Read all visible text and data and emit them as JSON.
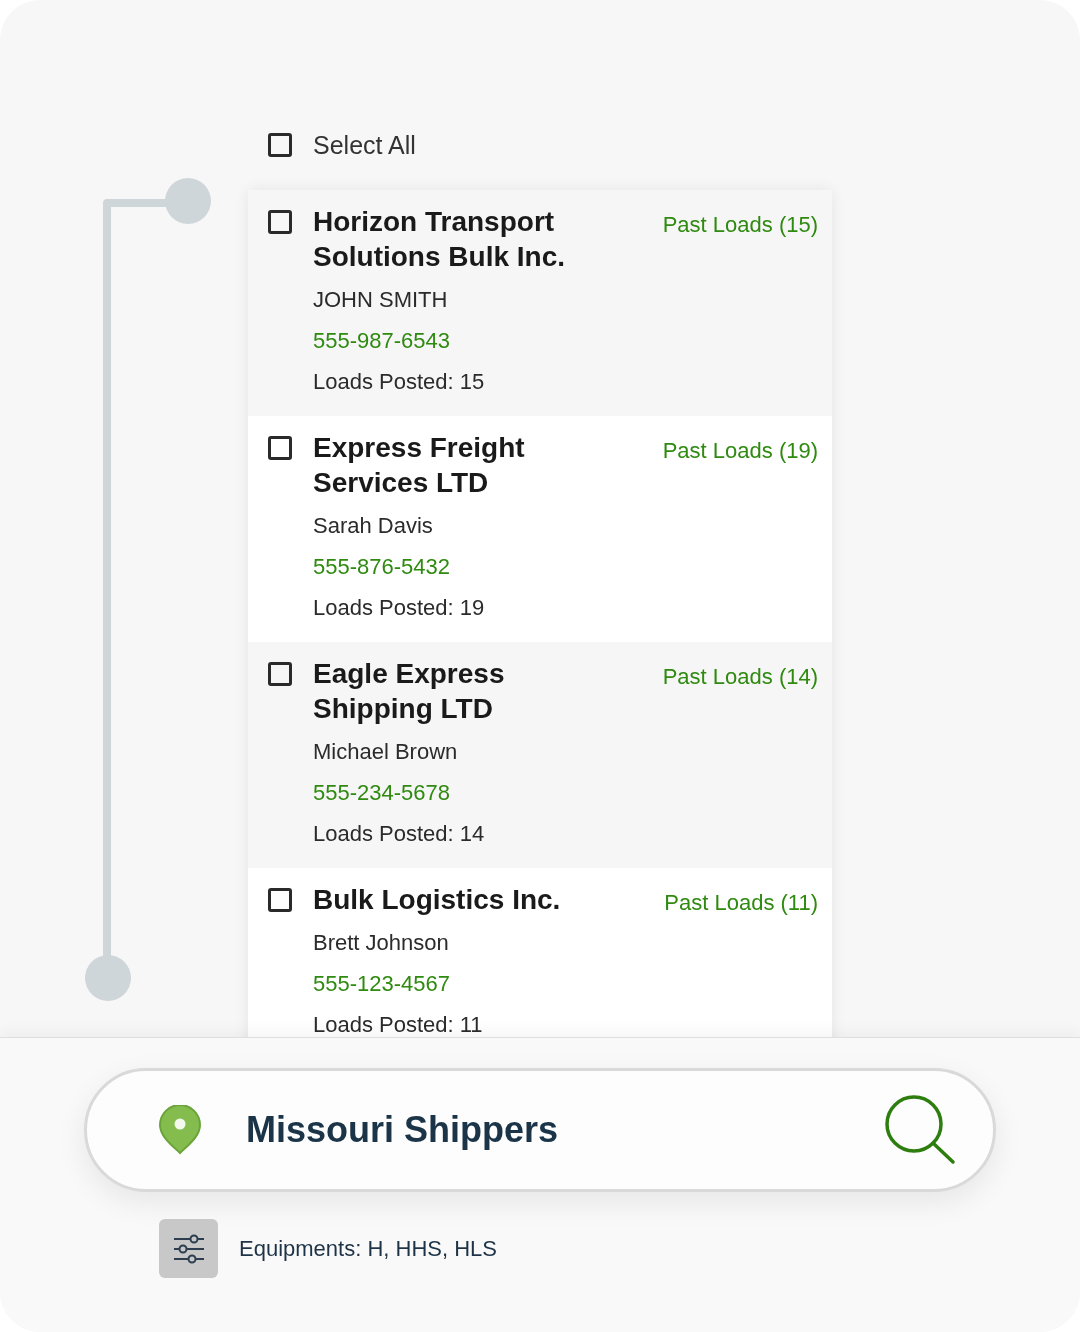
{
  "select_all": {
    "label": "Select All",
    "checked": false
  },
  "shippers": [
    {
      "name": "Horizon Transport Solutions Bulk Inc.",
      "past_loads": "Past Loads (15)",
      "contact": "JOHN SMITH",
      "phone": "555-987-6543",
      "loads_posted": "Loads Posted: 15",
      "checked": false
    },
    {
      "name": "Express Freight Services LTD",
      "past_loads": "Past Loads (19)",
      "contact": "Sarah Davis",
      "phone": "555-876-5432",
      "loads_posted": "Loads Posted: 19",
      "checked": false
    },
    {
      "name": "Eagle Express Shipping LTD",
      "past_loads": "Past Loads (14)",
      "contact": "Michael Brown",
      "phone": "555-234-5678",
      "loads_posted": "Loads Posted: 14",
      "checked": false
    },
    {
      "name": "Bulk Logistics Inc.",
      "past_loads": "Past Loads (11)",
      "contact": "Brett Johnson",
      "phone": "555-123-4567",
      "loads_posted": "Loads Posted: 11",
      "checked": false
    }
  ],
  "search": {
    "value": "Missouri Shippers"
  },
  "filter": {
    "label": "Equipments: H, HHS, HLS"
  }
}
